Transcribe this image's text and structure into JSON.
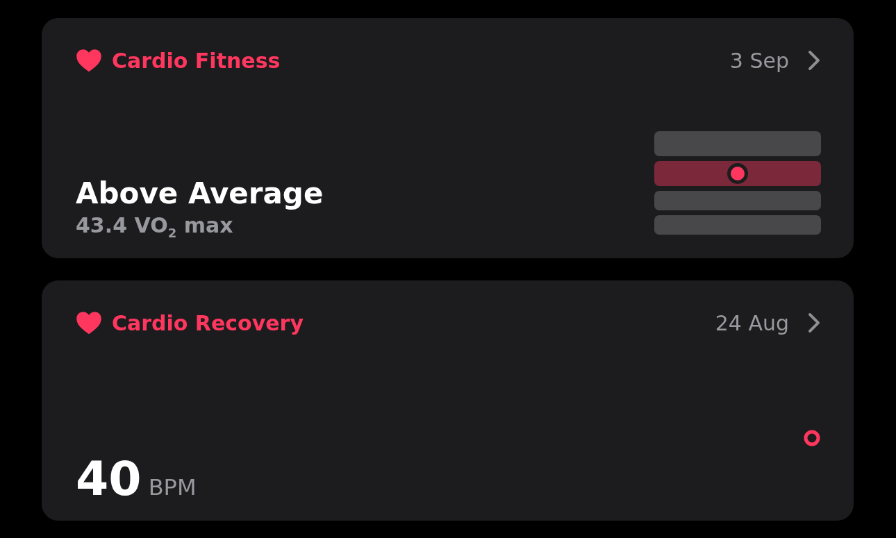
{
  "cards": [
    {
      "kind": "fitness",
      "title": "Cardio Fitness",
      "date": "3 Sep",
      "headline": "Above Average",
      "detail": "43.4 VO$_{2}$ max",
      "bands": [
        {
          "selected": false
        },
        {
          "selected": true,
          "level": 0.5
        },
        {
          "selected": false
        },
        {
          "selected": false
        }
      ]
    },
    {
      "kind": "recovery",
      "title": "Cardio Recovery",
      "date": "24 Aug",
      "value": "40",
      "unit": "BPM"
    }
  ]
}
